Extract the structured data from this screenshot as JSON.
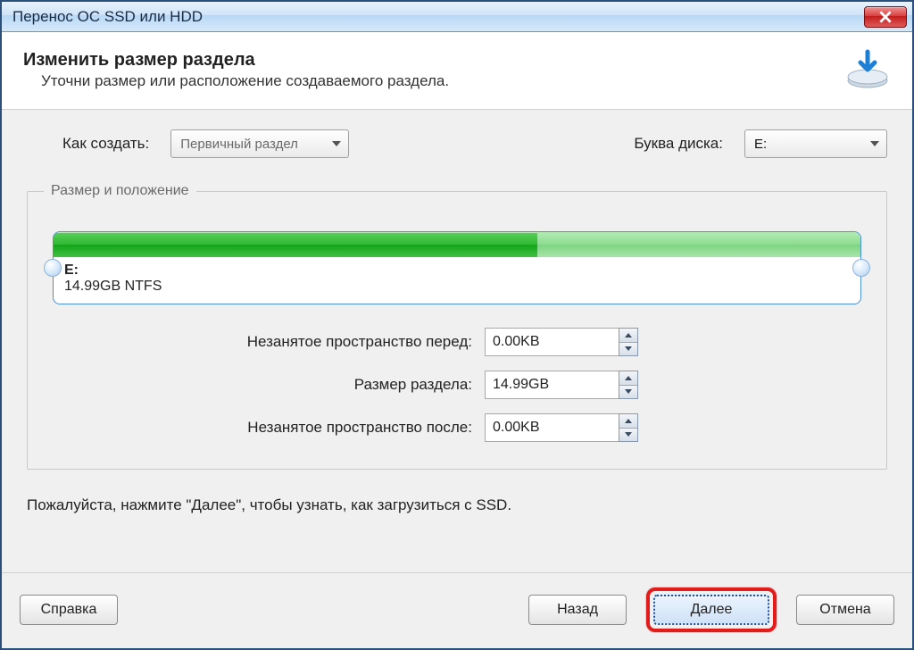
{
  "window": {
    "title": "Перенос ОС SSD или HDD"
  },
  "header": {
    "title": "Изменить размер раздела",
    "subtitle": "Уточни размер или расположение создаваемого раздела."
  },
  "options": {
    "create_label": "Как создать:",
    "create_value": "Первичный раздел",
    "drive_label": "Буква диска:",
    "drive_value": "E:"
  },
  "sizepos": {
    "legend": "Размер и положение",
    "partition_label": "E:",
    "partition_info": "14.99GB NTFS",
    "used_percent": 60
  },
  "fields": {
    "before_label": "Незанятое пространство перед:",
    "before_value": "0.00KB",
    "size_label": "Размер раздела:",
    "size_value": "14.99GB",
    "after_label": "Незанятое пространство после:",
    "after_value": "0.00KB"
  },
  "hint": "Пожалуйста, нажмите \"Далее\", чтобы узнать, как загрузиться с SSD.",
  "buttons": {
    "help": "Справка",
    "back": "Назад",
    "next": "Далее",
    "cancel": "Отмена"
  }
}
